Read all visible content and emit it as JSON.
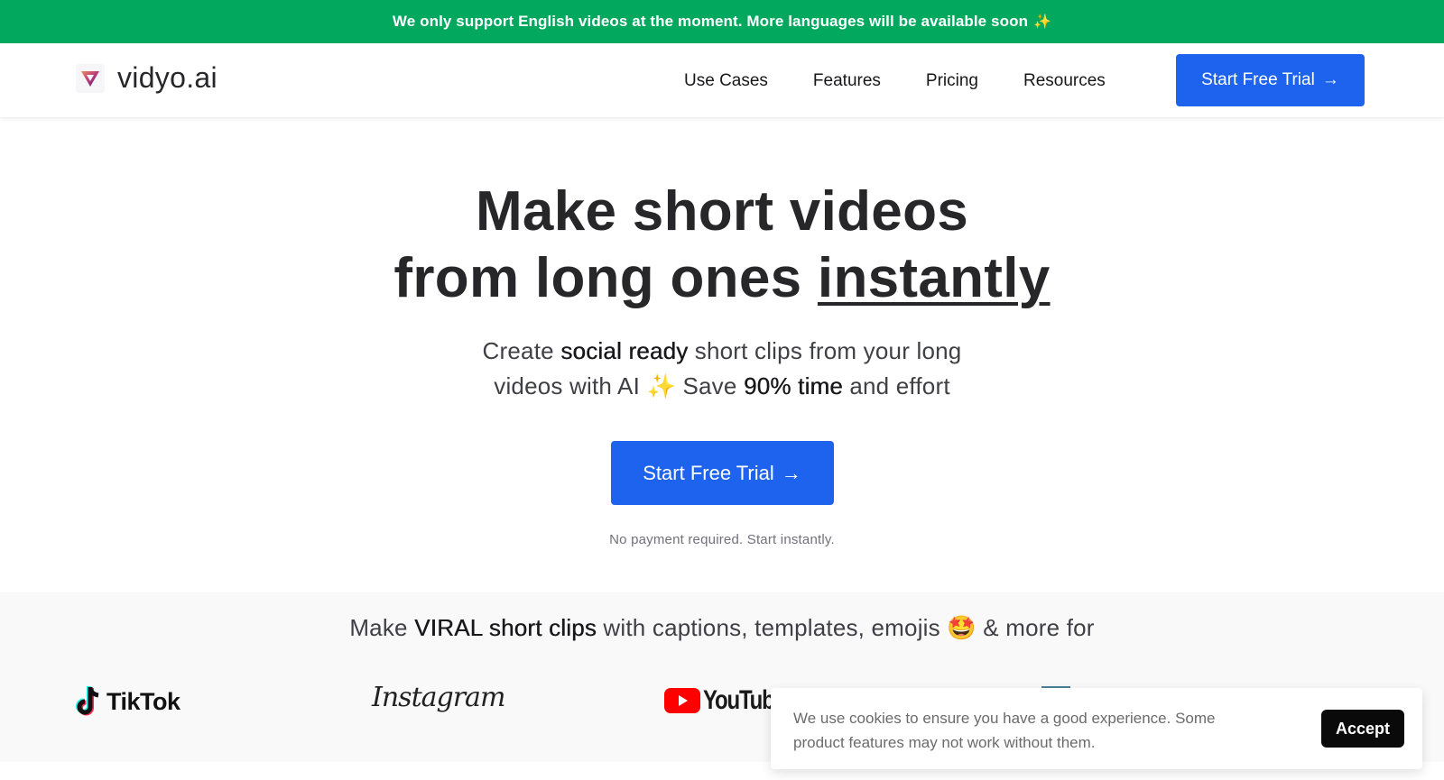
{
  "banner": {
    "text": "We only support English videos at the moment. More languages will be available soon",
    "icon": "sparkles-icon",
    "glyph": "✨"
  },
  "header": {
    "logo_text": "vidyo.ai",
    "nav": [
      {
        "label": "Use Cases"
      },
      {
        "label": "Features"
      },
      {
        "label": "Pricing"
      },
      {
        "label": "Resources"
      }
    ],
    "cta_label": "Start Free Trial",
    "cta_arrow": "→"
  },
  "hero": {
    "title_line1": "Make short videos",
    "title_line2_prefix": "from long ones ",
    "title_line2_emphasis": "instantly",
    "sub_1": "Create ",
    "sub_bold_1": "social ready",
    "sub_2": " short clips from your long",
    "sub_3": "videos with AI ",
    "sub_sparkle": "✨",
    "sub_4": " Save ",
    "sub_bold_2": "90% time",
    "sub_5": " and effort",
    "cta_label": "Start Free Trial",
    "cta_arrow": "→",
    "note": "No payment required. Start instantly."
  },
  "platforms": {
    "tagline_1": "Make ",
    "tagline_bold": "VIRAL short clips",
    "tagline_2": " with captions, templates, emojis ",
    "tagline_emoji": "🤩",
    "tagline_3": " & more for",
    "logos": [
      {
        "name": "TikTok",
        "icon": "tiktok-logo-icon"
      },
      {
        "name": "Instagram",
        "icon": "instagram-logo-icon"
      },
      {
        "name": "YouTube",
        "icon": "youtube-logo-icon"
      }
    ]
  },
  "cookie": {
    "text": "We use cookies to ensure you have a good experience. Some product features may not work without them.",
    "accept_label": "Accept"
  },
  "colors": {
    "banner_green": "#01a85e",
    "primary_blue": "#1d63ed",
    "text_dark": "#27272a"
  }
}
